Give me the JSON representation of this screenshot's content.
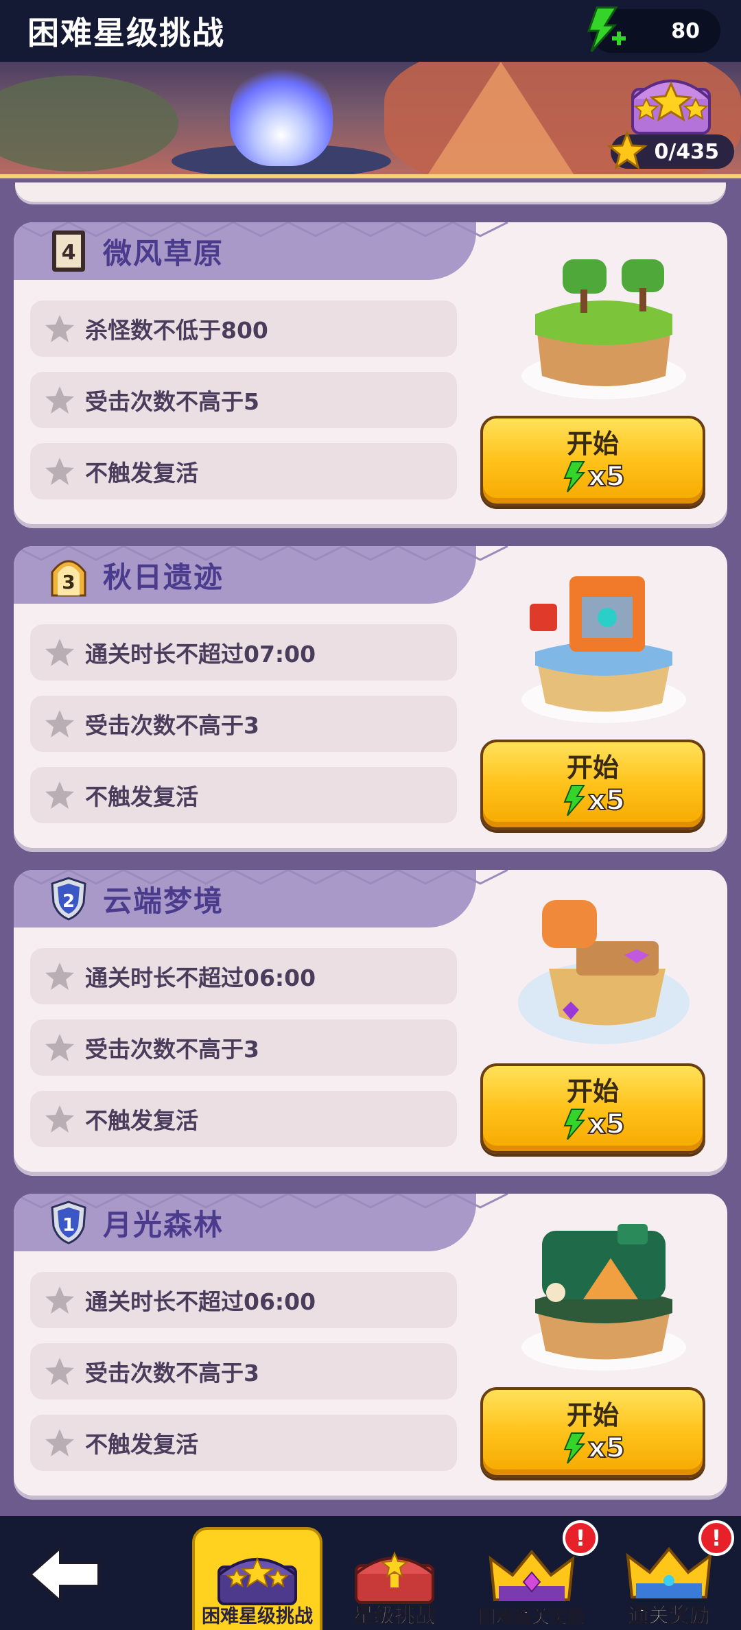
{
  "header": {
    "title": "困难星级挑战",
    "energy": "80"
  },
  "banner": {
    "star_progress": "0/435"
  },
  "levels": [
    {
      "number": "4",
      "name": "微风草原",
      "requirements": [
        "杀怪数不低于800",
        "受击次数不高于5",
        "不触发复活"
      ],
      "start_label": "开始",
      "cost": "x5"
    },
    {
      "number": "3",
      "name": "秋日遗迹",
      "requirements": [
        "通关时长不超过07:00",
        "受击次数不高于3",
        "不触发复活"
      ],
      "start_label": "开始",
      "cost": "x5"
    },
    {
      "number": "2",
      "name": "云端梦境",
      "requirements": [
        "通关时长不超过06:00",
        "受击次数不高于3",
        "不触发复活"
      ],
      "start_label": "开始",
      "cost": "x5"
    },
    {
      "number": "1",
      "name": "月光森林",
      "requirements": [
        "通关时长不超过06:00",
        "受击次数不高于3",
        "不触发复活"
      ],
      "start_label": "开始",
      "cost": "x5"
    }
  ],
  "nav": {
    "tabs": [
      {
        "label": "困难星级挑战",
        "active": true,
        "alert": false
      },
      {
        "label": "星级挑战",
        "active": false,
        "alert": false
      },
      {
        "label": "困难通关奖励",
        "active": false,
        "alert": true,
        "alert_text": "!"
      },
      {
        "label": "通关奖励",
        "active": false,
        "alert": true,
        "alert_text": "!"
      }
    ]
  },
  "colors": {
    "accent_yellow": "#ffc21a",
    "energy_green": "#3bd12a",
    "card_bg": "#f6eef0",
    "header_purple": "#a899c9"
  }
}
